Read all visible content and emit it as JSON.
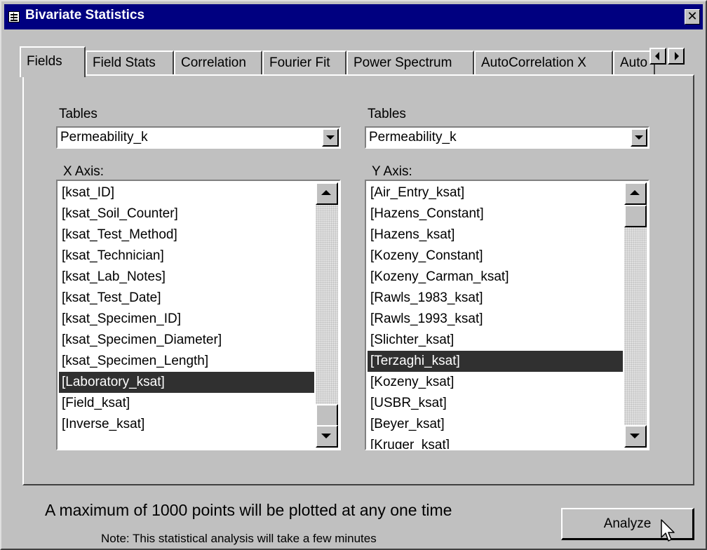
{
  "window": {
    "title": "Bivariate Statistics",
    "close_glyph": "✕"
  },
  "tabs": [
    {
      "label": "Fields",
      "active": true
    },
    {
      "label": "Field Stats"
    },
    {
      "label": "Correlation"
    },
    {
      "label": "Fourier Fit"
    },
    {
      "label": "Power Spectrum"
    },
    {
      "label": "AutoCorrelation X"
    },
    {
      "label": "Auto"
    }
  ],
  "left": {
    "tables_label": "Tables",
    "table_value": "Permeability_k",
    "axis_label": "X Axis:",
    "items": [
      "[ksat_ID]",
      "[ksat_Soil_Counter]",
      "[ksat_Test_Method]",
      "[ksat_Technician]",
      "[ksat_Lab_Notes]",
      "[ksat_Test_Date]",
      "[ksat_Specimen_ID]",
      "[ksat_Specimen_Diameter]",
      "[ksat_Specimen_Length]",
      "[Laboratory_ksat]",
      "[Field_ksat]",
      "[Inverse_ksat]"
    ],
    "selected": "[Laboratory_ksat]"
  },
  "right": {
    "tables_label": "Tables",
    "table_value": "Permeability_k",
    "axis_label": "Y Axis:",
    "items": [
      "[Air_Entry_ksat]",
      "[Hazens_Constant]",
      "[Hazens_ksat]",
      "[Kozeny_Constant]",
      "[Kozeny_Carman_ksat]",
      "[Rawls_1983_ksat]",
      "[Rawls_1993_ksat]",
      "[Slichter_ksat]",
      "[Terzaghi_ksat]",
      "[Kozeny_ksat]",
      "[USBR_ksat]",
      "[Beyer_ksat]",
      "[Kruger_ksat]"
    ],
    "selected": "[Terzaghi_ksat]"
  },
  "footer": {
    "max_points_text": "A maximum of 1000 points will be plotted at any one time",
    "note_text": "Note: This statistical analysis will take a few minutes",
    "analyze_label": "Analyze"
  },
  "icons": {
    "title": "form-icon",
    "cursor": "arrow-cursor-icon"
  }
}
